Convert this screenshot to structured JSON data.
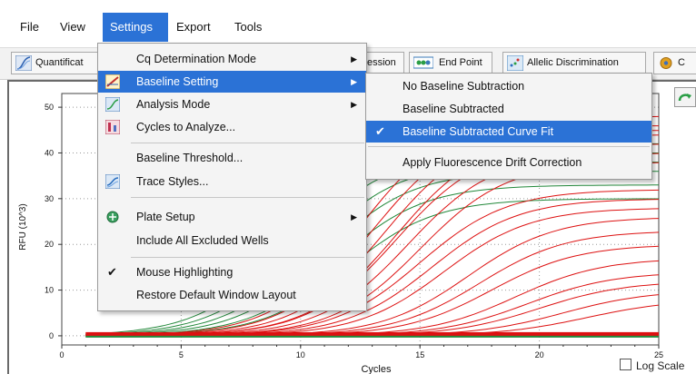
{
  "menubar": {
    "items": [
      "File",
      "View",
      "Settings",
      "Export",
      "Tools"
    ]
  },
  "toolbar": {
    "buttons": [
      "Quantificat",
      "ession",
      "End Point",
      "Allelic Discrimination",
      "C"
    ]
  },
  "settings_menu": {
    "items": [
      {
        "label": "Cq Determination Mode",
        "submenu": true
      },
      {
        "label": "Baseline Setting",
        "submenu": true,
        "highlighted": true
      },
      {
        "label": "Analysis Mode",
        "submenu": true
      },
      {
        "label": "Cycles to Analyze..."
      },
      {
        "label": "Baseline Threshold..."
      },
      {
        "label": "Trace Styles..."
      },
      {
        "label": "Plate Setup",
        "submenu": true
      },
      {
        "label": "Include All Excluded Wells"
      },
      {
        "label": "Mouse Highlighting",
        "checked": true
      },
      {
        "label": "Restore Default Window Layout"
      }
    ]
  },
  "baseline_submenu": {
    "items": [
      {
        "label": "No Baseline Subtraction"
      },
      {
        "label": "Baseline Subtracted"
      },
      {
        "label": "Baseline Subtracted Curve Fit",
        "checked": true,
        "highlighted": true
      },
      {
        "label": "Apply Fluorescence Drift Correction"
      }
    ]
  },
  "chart": {
    "ylabel": "RFU (10^3)",
    "xlabel": "Cycles",
    "log_scale_label": "Log Scale",
    "log_scale_checked": false,
    "x_ticks": [
      "0",
      "5",
      "10",
      "15",
      "20",
      "25"
    ],
    "y_ticks": [
      "0",
      "10",
      "20",
      "30",
      "40",
      "50"
    ]
  },
  "chart_data": {
    "type": "line",
    "xlabel": "Cycles",
    "ylabel": "RFU (10^3)",
    "xlim": [
      0,
      25
    ],
    "ylim": [
      -2,
      53
    ],
    "x_ticks": [
      0,
      5,
      10,
      15,
      20,
      25
    ],
    "y_ticks": [
      0,
      10,
      20,
      30,
      40,
      50
    ],
    "grid": "dotted",
    "series_colors": {
      "red": "#dd1111",
      "green": "#22883a"
    },
    "red_curves_plateau": [
      8,
      10,
      12,
      14,
      17,
      20,
      23,
      26,
      28,
      30,
      32,
      38,
      40,
      42,
      44,
      45,
      46,
      48
    ],
    "red_curves_midpoint": [
      22,
      21,
      20,
      19.5,
      19,
      18,
      17.5,
      17,
      16,
      15.5,
      15,
      15,
      14.5,
      14,
      14,
      13.5,
      13,
      12.5
    ],
    "green_curves_plateau": [
      30,
      33,
      36,
      38,
      40,
      42
    ],
    "green_curves_midpoint": [
      12,
      11.5,
      11,
      10.5,
      10,
      9.5
    ]
  },
  "colors": {
    "accent": "#2b72d6",
    "menu_bg": "#f4f4f4",
    "red_trace": "#dd1111",
    "green_trace": "#22883a"
  }
}
